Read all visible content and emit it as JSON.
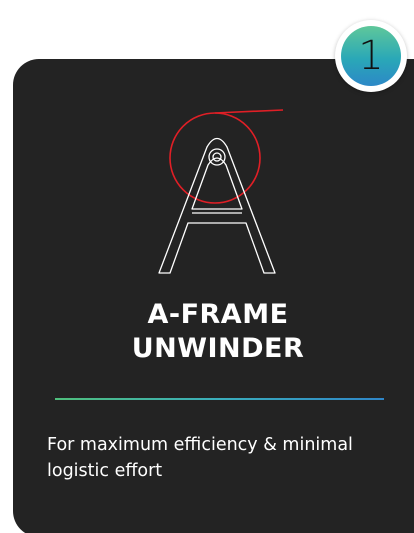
{
  "badge": {
    "number": "1",
    "gradient_colors": [
      "#5fc79a",
      "#2aa8b7",
      "#2c88c7"
    ]
  },
  "card": {
    "background_color": "#232323",
    "icon": "a-frame-unwinder-icon",
    "title_line1": "A-FRAME",
    "title_line2": "UNWINDER",
    "description": "For maximum efficiency & minimal logistic effort",
    "accent_red": "#e01f26"
  }
}
